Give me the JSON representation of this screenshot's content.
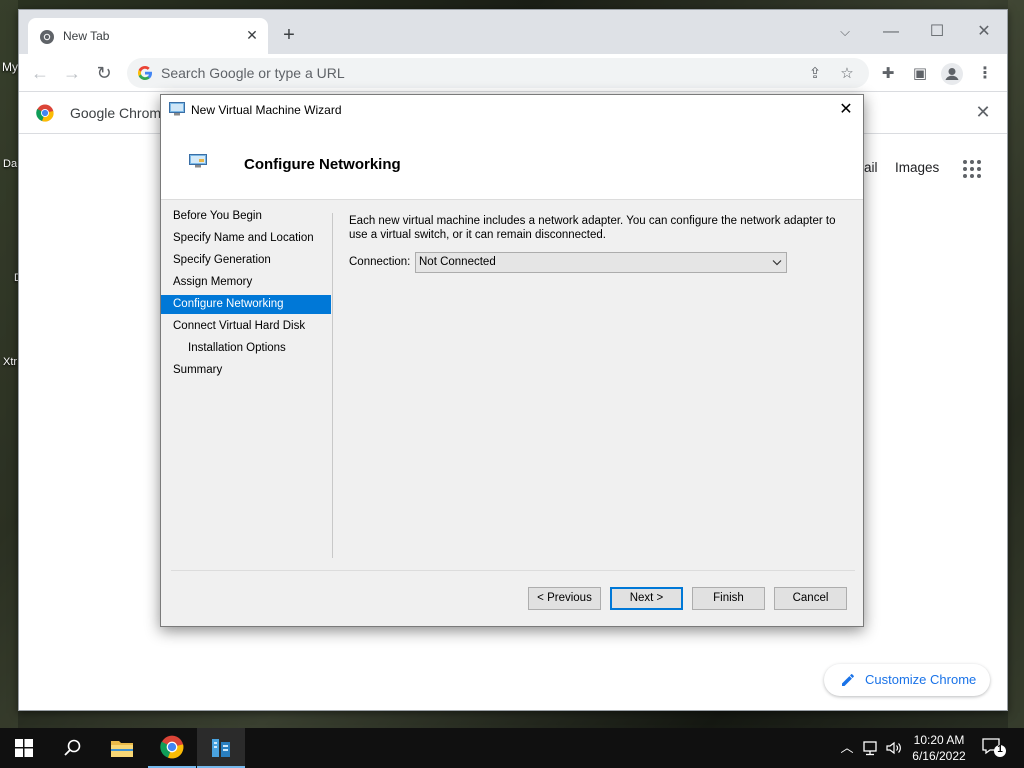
{
  "desktop": {
    "icon_labels": [
      "My",
      "Da",
      "D",
      "Xtr"
    ]
  },
  "browser": {
    "tab_title": "New Tab",
    "omnibox_placeholder": "Search Google or type a URL",
    "infobar_text": "Google Chrome",
    "ntp_links": {
      "gmail_partial": "ail",
      "images": "Images"
    },
    "customize_label": "Customize Chrome"
  },
  "wizard": {
    "title": "New Virtual Machine Wizard",
    "header": "Configure Networking",
    "steps": [
      {
        "label": "Before You Begin"
      },
      {
        "label": "Specify Name and Location"
      },
      {
        "label": "Specify Generation"
      },
      {
        "label": "Assign Memory"
      },
      {
        "label": "Configure Networking",
        "active": true
      },
      {
        "label": "Connect Virtual Hard Disk"
      },
      {
        "label": "Installation Options",
        "sub": true
      },
      {
        "label": "Summary"
      }
    ],
    "description": "Each new virtual machine includes a network adapter. You can configure the network adapter to use a virtual switch, or it can remain disconnected.",
    "connection_label": "Connection:",
    "connection_value": "Not Connected",
    "buttons": {
      "previous": "< Previous",
      "next": "Next >",
      "finish": "Finish",
      "cancel": "Cancel"
    }
  },
  "taskbar": {
    "time": "10:20 AM",
    "date": "6/16/2022",
    "notification_count": "1"
  }
}
